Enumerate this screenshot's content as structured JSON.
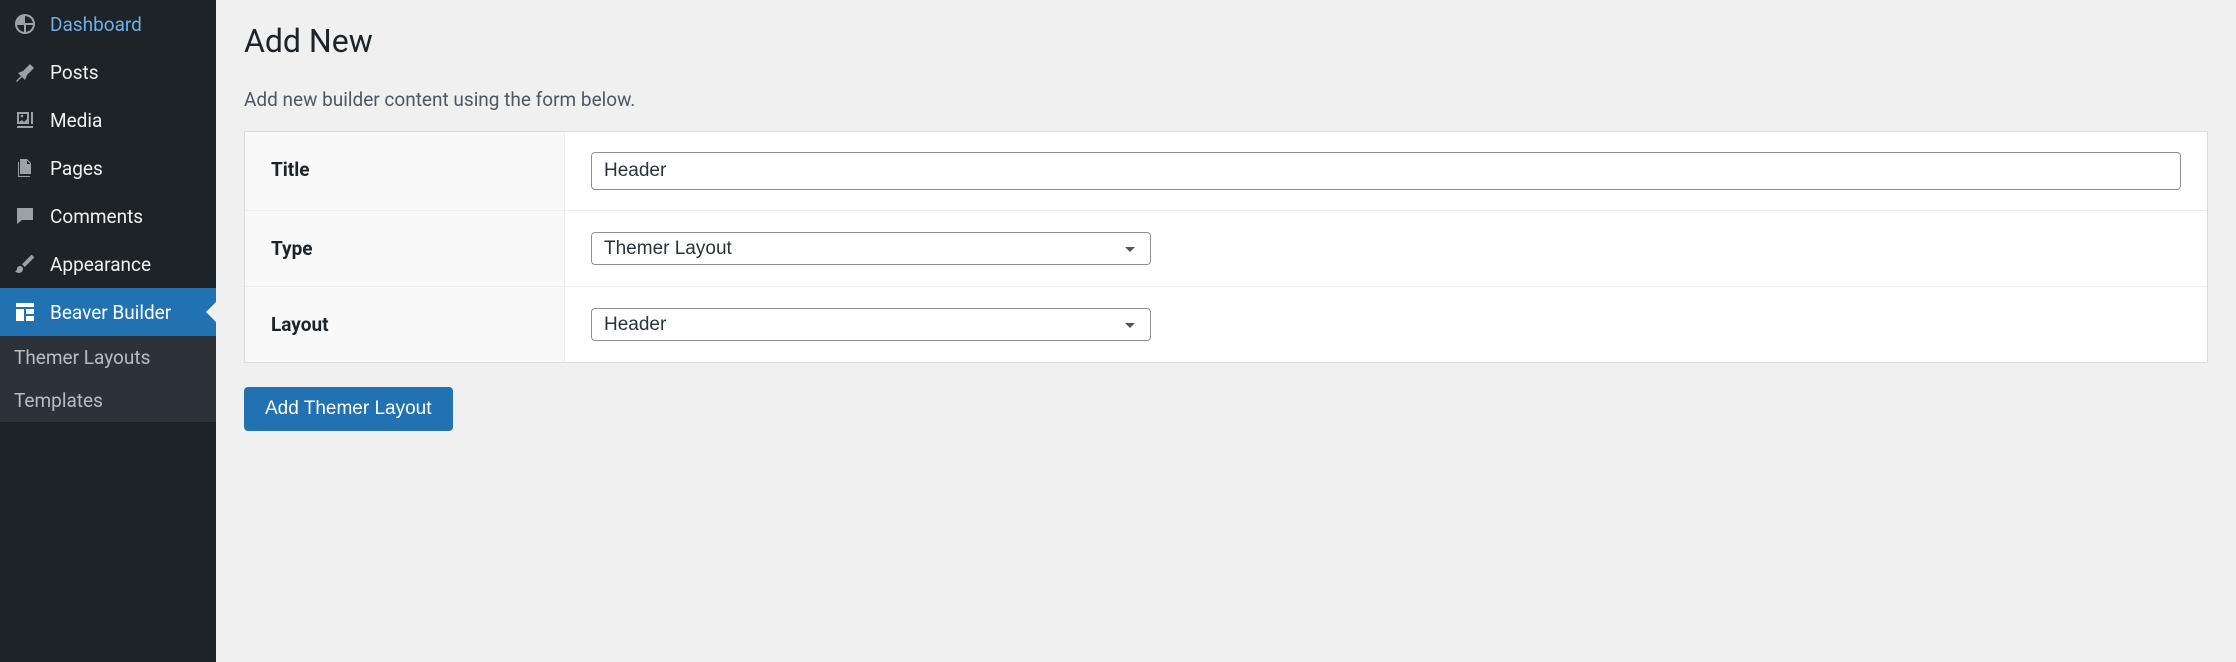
{
  "sidebar": {
    "items": [
      {
        "label": "Dashboard"
      },
      {
        "label": "Posts"
      },
      {
        "label": "Media"
      },
      {
        "label": "Pages"
      },
      {
        "label": "Comments"
      },
      {
        "label": "Appearance"
      },
      {
        "label": "Beaver Builder"
      }
    ],
    "sub": [
      {
        "label": "Themer Layouts"
      },
      {
        "label": "Templates"
      }
    ]
  },
  "main": {
    "title": "Add New",
    "description": "Add new builder content using the form below.",
    "form": {
      "title_label": "Title",
      "title_value": "Header",
      "type_label": "Type",
      "type_value": "Themer Layout",
      "layout_label": "Layout",
      "layout_value": "Header"
    },
    "submit_label": "Add Themer Layout"
  }
}
